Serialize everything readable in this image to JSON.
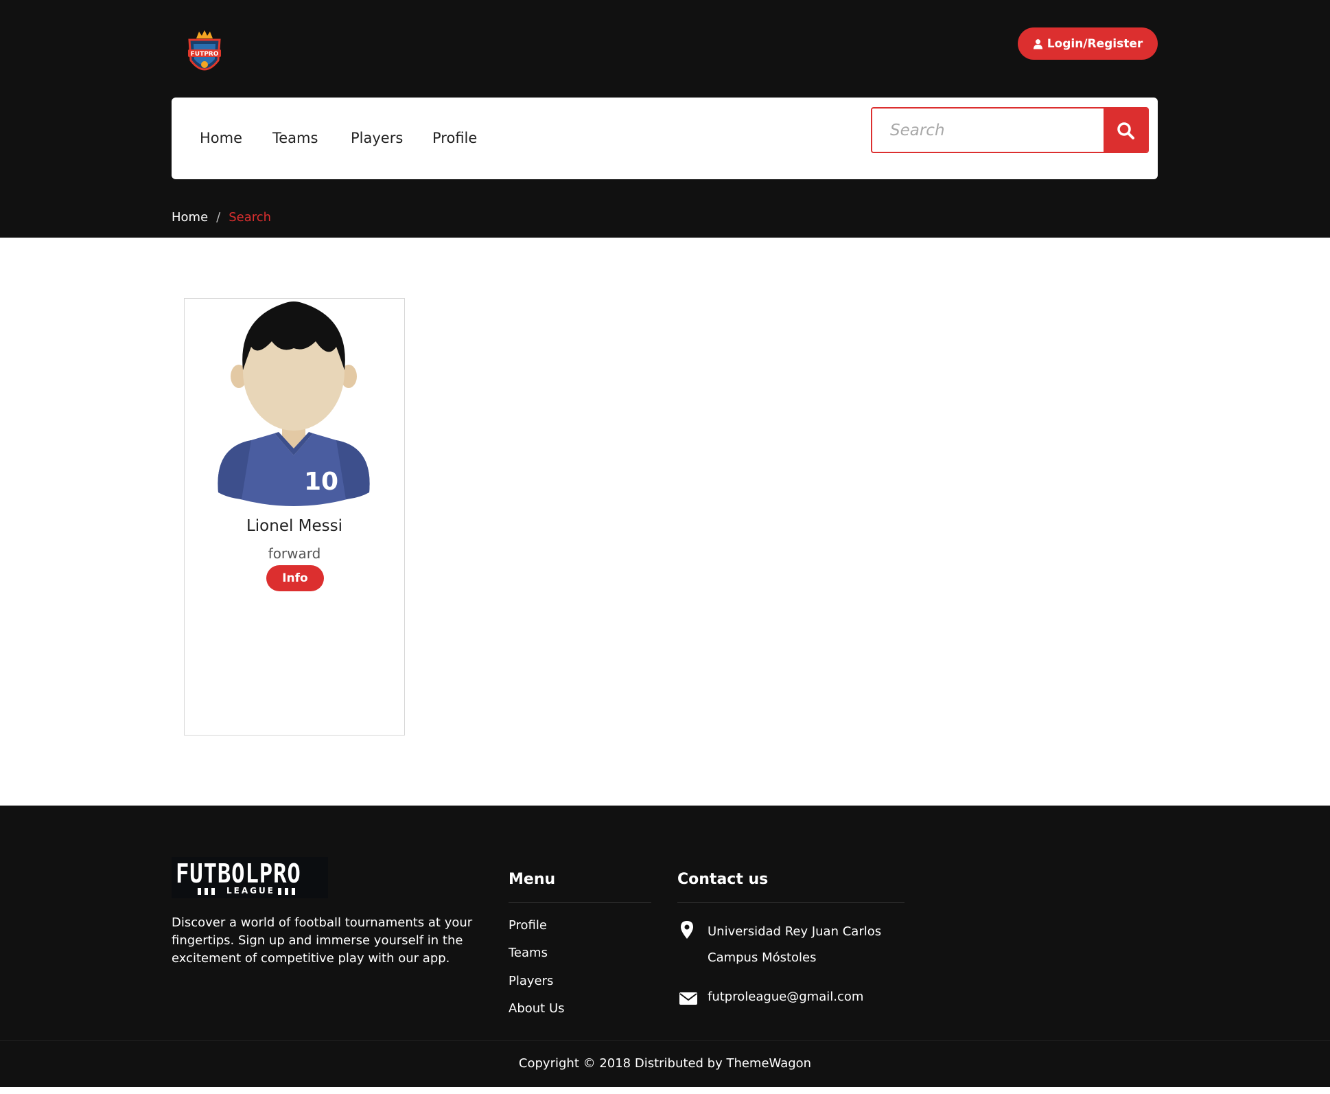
{
  "header": {
    "login_label": "Login/Register"
  },
  "nav": {
    "items": [
      "Home",
      "Teams",
      "Players",
      "Profile"
    ],
    "search_placeholder": "Search"
  },
  "breadcrumb": {
    "home": "Home",
    "separator": "/",
    "current": "Search"
  },
  "results": [
    {
      "jersey_number": "10",
      "name": "Lionel Messi",
      "position": "forward",
      "info_label": "Info"
    }
  ],
  "footer": {
    "logo_text": "FUTBOLPRO",
    "logo_subtext": "LEAGUE",
    "description": "Discover a world of football tournaments at your fingertips. Sign up and immerse yourself in the excitement of competitive play with our app.",
    "menu_title": "Menu",
    "menu_items": [
      "Profile",
      "Teams",
      "Players",
      "About Us"
    ],
    "contact_title": "Contact us",
    "address_line1": "Universidad Rey Juan Carlos",
    "address_line2": "Campus Móstoles",
    "email": "futproleague@gmail.com",
    "copyright": "Copyright © 2018 Distributed by ThemeWagon"
  },
  "colors": {
    "accent": "#dc2f2f",
    "dark_background": "#111111",
    "jersey": "#4a5da0"
  },
  "icons": [
    "user-icon",
    "search-icon",
    "map-marker-icon",
    "envelope-icon"
  ]
}
